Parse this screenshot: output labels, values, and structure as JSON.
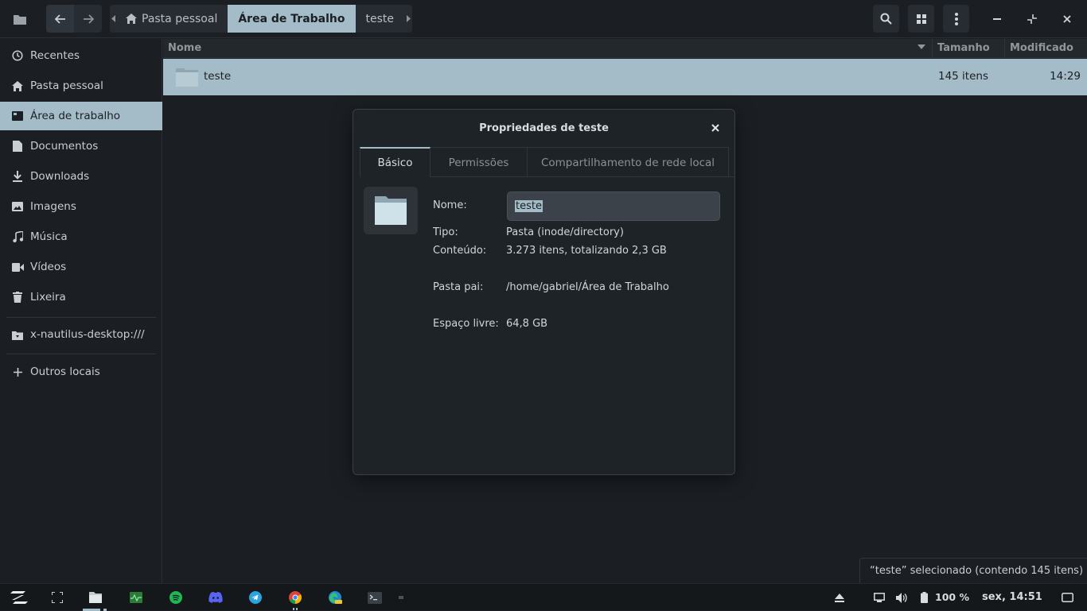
{
  "header": {
    "breadcrumbs": [
      "Pasta pessoal",
      "Área de Trabalho",
      "teste"
    ]
  },
  "sidebar": {
    "items": [
      {
        "label": "Recentes",
        "icon": "clock-icon"
      },
      {
        "label": "Pasta pessoal",
        "icon": "home-icon"
      },
      {
        "label": "Área de trabalho",
        "icon": "desktop-icon",
        "active": true
      },
      {
        "label": "Documentos",
        "icon": "document-icon"
      },
      {
        "label": "Downloads",
        "icon": "download-icon"
      },
      {
        "label": "Imagens",
        "icon": "image-icon"
      },
      {
        "label": "Música",
        "icon": "music-icon"
      },
      {
        "label": "Vídeos",
        "icon": "video-icon"
      },
      {
        "label": "Lixeira",
        "icon": "trash-icon"
      }
    ],
    "mount": "x-nautilus-desktop:///",
    "other_locations": "Outros locais"
  },
  "list": {
    "columns": {
      "name": "Nome",
      "size": "Tamanho",
      "modified": "Modificado"
    },
    "rows": [
      {
        "name": "teste",
        "size": "145 itens",
        "modified": "14:29"
      }
    ]
  },
  "status": "“teste” selecionado  (contendo 145 itens)",
  "dialog": {
    "title": "Propriedades de teste",
    "tabs": [
      "Básico",
      "Permissões",
      "Compartilhamento de rede local"
    ],
    "name_label": "Nome:",
    "name_value": "teste",
    "type_label": "Tipo:",
    "type_value": "Pasta (inode/directory)",
    "content_label": "Conteúdo:",
    "content_value": "3.273 itens, totalizando 2,3 GB",
    "parent_label": "Pasta pai:",
    "parent_value": "/home/gabriel/Área de Trabalho",
    "free_label": "Espaço livre:",
    "free_value": "64,8 GB"
  },
  "taskbar": {
    "battery": "100 %",
    "clock": "sex, 14:51"
  },
  "colors": {
    "accent": "#a4bcc7",
    "background": "#1b1f23",
    "spotify": "#1db954",
    "discord": "#5865f2",
    "telegram": "#2aa3e0"
  }
}
